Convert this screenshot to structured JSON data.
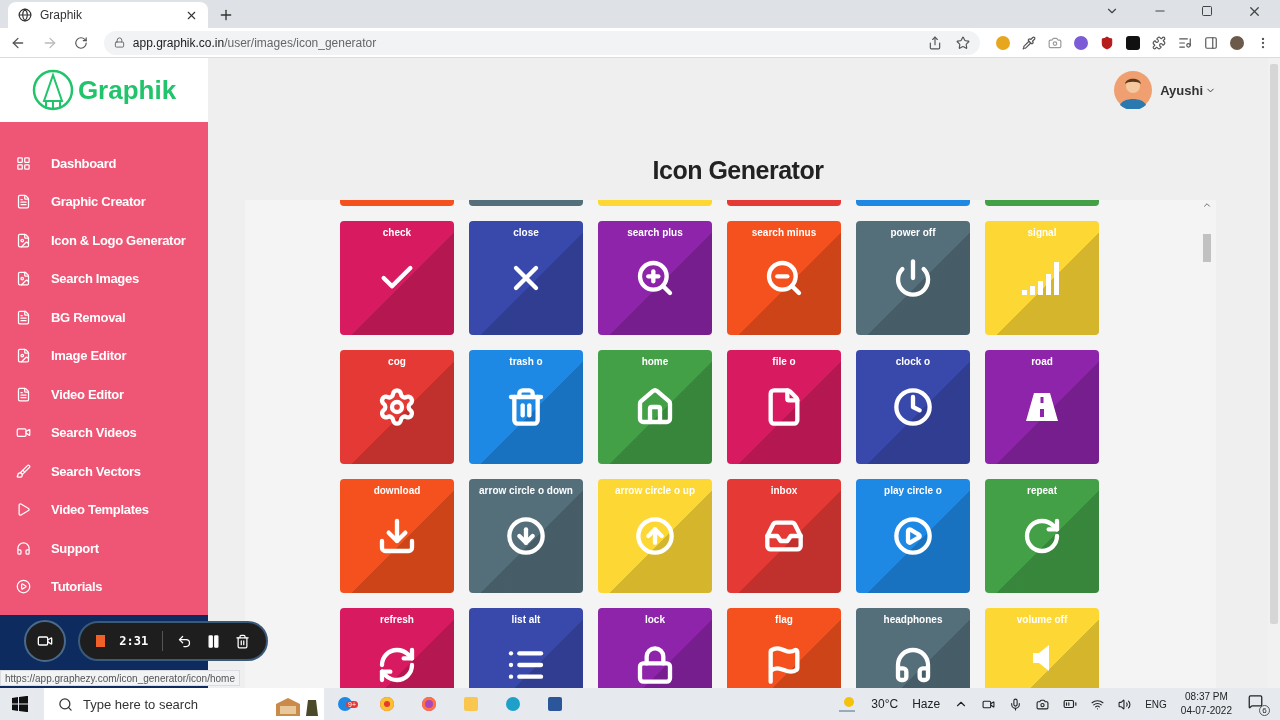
{
  "browser": {
    "tab": {
      "title": "Graphik"
    },
    "url": {
      "host": "app.graphik.co.in",
      "path": "/user/images/icon_generator"
    }
  },
  "sidebar": {
    "logo": "Graphik",
    "items": [
      {
        "label": "Dashboard"
      },
      {
        "label": "Graphic Creator"
      },
      {
        "label": "Icon & Logo Generator"
      },
      {
        "label": "Search Images"
      },
      {
        "label": "BG Removal"
      },
      {
        "label": "Image Editor"
      },
      {
        "label": "Video Editor"
      },
      {
        "label": "Search Videos"
      },
      {
        "label": "Search Vectors"
      },
      {
        "label": "Video Templates"
      },
      {
        "label": "Support"
      },
      {
        "label": "Tutorials"
      }
    ]
  },
  "user": {
    "name": "Ayushi"
  },
  "page_title": "Icon Generator",
  "grid": {
    "partial_row": [
      {
        "color": "#f4511e"
      },
      {
        "color": "#546e7a"
      },
      {
        "color": "#fdd835"
      },
      {
        "color": "#e53935"
      },
      {
        "color": "#1e88e5"
      },
      {
        "color": "#43a047"
      }
    ],
    "tiles": [
      {
        "label": "check",
        "color": "#d81b60"
      },
      {
        "label": "close",
        "color": "#3949ab"
      },
      {
        "label": "search plus",
        "color": "#8e24aa"
      },
      {
        "label": "search minus",
        "color": "#f4511e"
      },
      {
        "label": "power off",
        "color": "#546e7a"
      },
      {
        "label": "signal",
        "color": "#fdd835"
      },
      {
        "label": "cog",
        "color": "#e53935"
      },
      {
        "label": "trash o",
        "color": "#1e88e5"
      },
      {
        "label": "home",
        "color": "#43a047"
      },
      {
        "label": "file o",
        "color": "#d81b60"
      },
      {
        "label": "clock o",
        "color": "#3949ab"
      },
      {
        "label": "road",
        "color": "#8e24aa"
      },
      {
        "label": "download",
        "color": "#f4511e"
      },
      {
        "label": "arrow circle o down",
        "color": "#546e7a"
      },
      {
        "label": "arrow circle o up",
        "color": "#fdd835"
      },
      {
        "label": "inbox",
        "color": "#e53935"
      },
      {
        "label": "play circle o",
        "color": "#1e88e5"
      },
      {
        "label": "repeat",
        "color": "#43a047"
      },
      {
        "label": "refresh",
        "color": "#d81b60"
      },
      {
        "label": "list alt",
        "color": "#3949ab"
      },
      {
        "label": "lock",
        "color": "#8e24aa"
      },
      {
        "label": "flag",
        "color": "#f4511e"
      },
      {
        "label": "headphones",
        "color": "#546e7a"
      },
      {
        "label": "volume off",
        "color": "#fdd835"
      }
    ]
  },
  "recorder": {
    "time": "2:31"
  },
  "status_url": "https://app.graphezy.com/icon_generator/icon/home",
  "taskbar": {
    "search": {
      "placeholder": "Type here to search"
    },
    "app_badge": "9+",
    "temperature": "30°C",
    "condition": "Haze",
    "language": "ENG",
    "time": "08:37 PM",
    "date": "04-07-2022",
    "notifications": "6"
  }
}
